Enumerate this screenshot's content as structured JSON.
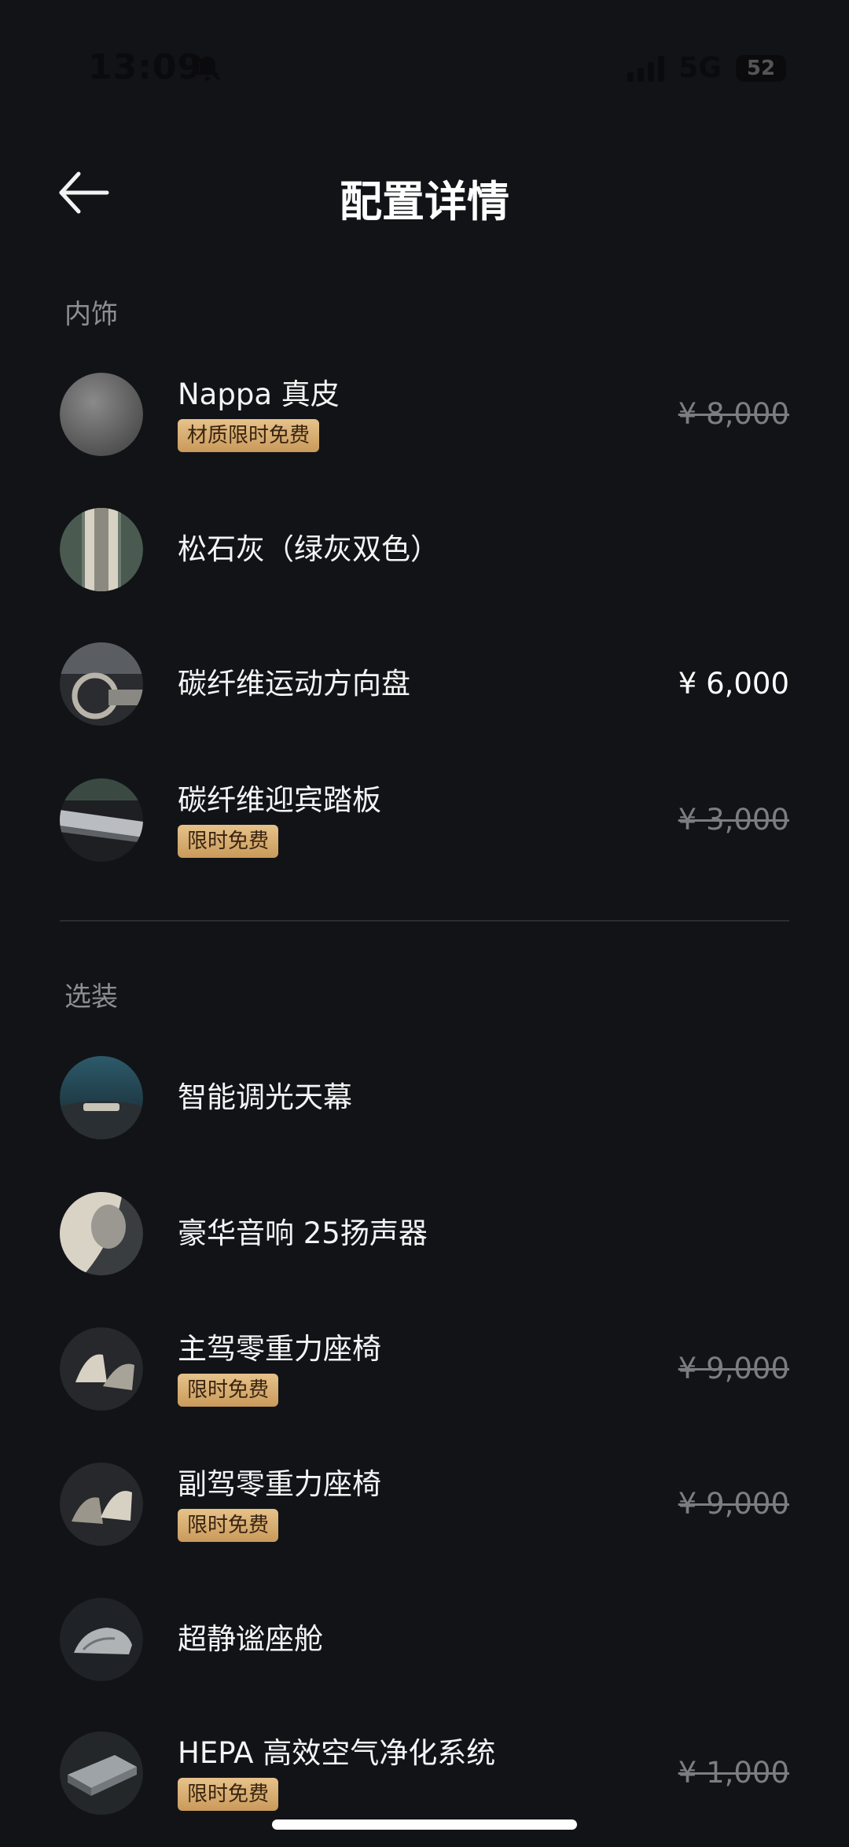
{
  "status": {
    "time": "13:09",
    "network": "5G",
    "battery": "52"
  },
  "header": {
    "title": "配置详情"
  },
  "sections": {
    "interior": {
      "title": "内饰",
      "items": [
        {
          "name": "Nappa 真皮",
          "badge": "材质限时免费",
          "price": "¥ 8,000"
        },
        {
          "name": "松石灰（绿灰双色）",
          "badge": "",
          "price": ""
        },
        {
          "name": "碳纤维运动方向盘",
          "badge": "",
          "price": "¥ 6,000"
        },
        {
          "name": "碳纤维迎宾踏板",
          "badge": "限时免费",
          "price": "¥ 3,000"
        }
      ]
    },
    "options": {
      "title": "选装",
      "items": [
        {
          "name": "智能调光天幕",
          "badge": "",
          "price": ""
        },
        {
          "name": "豪华音响 25扬声器",
          "badge": "",
          "price": ""
        },
        {
          "name": "主驾零重力座椅",
          "badge": "限时免费",
          "price": "¥ 9,000"
        },
        {
          "name": "副驾零重力座椅",
          "badge": "限时免费",
          "price": "¥ 9,000"
        },
        {
          "name": "超静谧座舱",
          "badge": "",
          "price": ""
        },
        {
          "name": "HEPA 高效空气净化系统",
          "badge": "限时免费",
          "price": "¥ 1,000"
        }
      ]
    }
  }
}
